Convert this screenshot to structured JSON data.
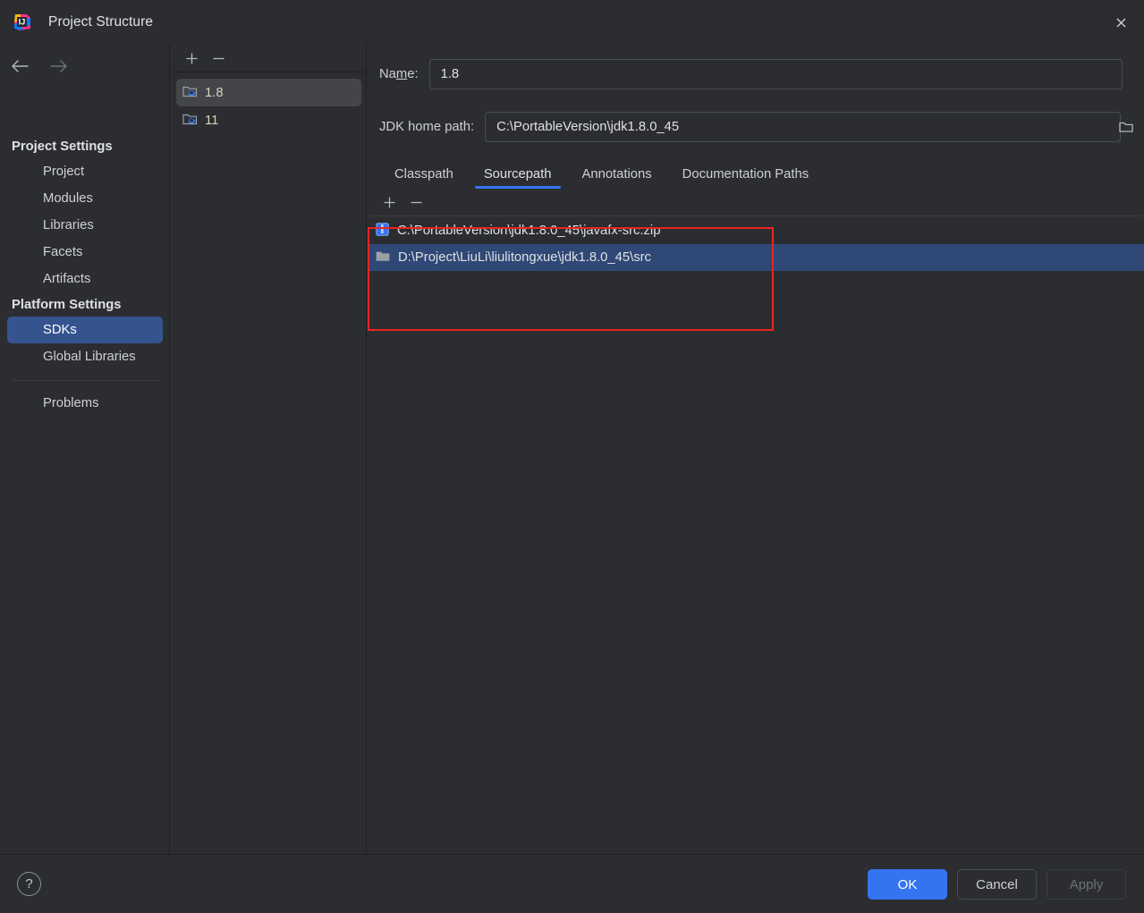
{
  "window": {
    "title": "Project Structure",
    "logo_icon": "intellij-idea-logo",
    "close_icon": "close-icon"
  },
  "nav": {
    "back_icon": "arrow-left-icon",
    "forward_icon": "arrow-right-icon",
    "groups": [
      {
        "label": "Project Settings",
        "items": [
          {
            "label": "Project",
            "selected": false
          },
          {
            "label": "Modules",
            "selected": false
          },
          {
            "label": "Libraries",
            "selected": false
          },
          {
            "label": "Facets",
            "selected": false
          },
          {
            "label": "Artifacts",
            "selected": false
          }
        ]
      },
      {
        "label": "Platform Settings",
        "items": [
          {
            "label": "SDKs",
            "selected": true
          },
          {
            "label": "Global Libraries",
            "selected": false
          }
        ]
      }
    ],
    "extra_items": [
      {
        "label": "Problems",
        "selected": false
      }
    ]
  },
  "sdk_list": {
    "toolbar": {
      "add_label": "+",
      "remove_label": "—",
      "add_icon": "plus-icon",
      "remove_icon": "minus-icon"
    },
    "items": [
      {
        "label": "1.8",
        "icon": "jdk-folder-icon",
        "selected": true
      },
      {
        "label": "11",
        "icon": "jdk-folder-icon",
        "selected": false
      }
    ]
  },
  "detail": {
    "name_field": {
      "label_pre": "Na",
      "label_mnemonic": "m",
      "label_post": "e:",
      "value": "1.8",
      "placeholder": ""
    },
    "home_path_field": {
      "label": "JDK home path:",
      "value": "C:\\PortableVersion\\jdk1.8.0_45",
      "placeholder": "",
      "browse_icon": "folder-icon"
    },
    "tabs": [
      {
        "label": "Classpath",
        "active": false
      },
      {
        "label": "Sourcepath",
        "active": true
      },
      {
        "label": "Annotations",
        "active": false
      },
      {
        "label": "Documentation Paths",
        "active": false
      }
    ],
    "paths_toolbar": {
      "add_label": "+",
      "remove_label": "—",
      "add_icon": "plus-icon",
      "remove_icon": "minus-icon"
    },
    "paths": [
      {
        "label": "C:\\PortableVersion\\jdk1.8.0_45\\javafx-src.zip",
        "icon": "zip-archive-icon",
        "selected": false
      },
      {
        "label": "D:\\Project\\LiuLi\\liulitongxue\\jdk1.8.0_45\\src",
        "icon": "folder-icon",
        "selected": true
      }
    ]
  },
  "footer": {
    "help_label": "?",
    "help_icon": "help-icon",
    "ok_label": "OK",
    "cancel_label": "Cancel",
    "apply_label": "Apply"
  },
  "colors": {
    "background": "#2b2d30",
    "accent": "#3574f0",
    "selection_blue": "#2f4875",
    "nav_selection": "#35538f",
    "row_selection_gray": "#43454a",
    "annotation_red": "#ee2222",
    "text_primary": "#dfe1e5",
    "text_secondary": "#ced0d6",
    "jdk_label": "#d9d2bc"
  }
}
